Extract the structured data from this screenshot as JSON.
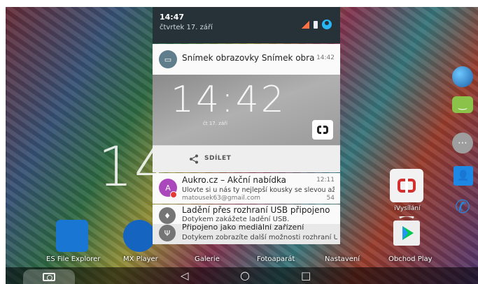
{
  "home": {
    "big_clock": "14",
    "apps": [
      {
        "label": "ES File Explorer"
      },
      {
        "label": "MX Player"
      },
      {
        "label": "Galerie"
      },
      {
        "label": "Fotoaparát"
      },
      {
        "label": "Nastavení"
      },
      {
        "label": "Obchod Play"
      }
    ],
    "ivysilani_label": "iVysílání"
  },
  "shade": {
    "time": "14:47",
    "date": "čtvrtek 17. září"
  },
  "notifications": {
    "screenshot": {
      "title": "Snímek obrazovky Snímek obrazo..",
      "time": "14:42",
      "preview_clock": "14:42",
      "preview_date": "čt 17. září",
      "share_label": "SDÍLET"
    },
    "aukro": {
      "avatar": "A",
      "title": "Aukro.cz – Akční nabídka",
      "time": "12:11",
      "text": "Ulovte si u nás ty nejlepší kousky se slevou až 50 %",
      "sub": "matousek63@gmail.com",
      "count": "54"
    },
    "usb": {
      "title": "Ladění přes rozhraní USB připojeno",
      "text": "Dotykem zakážete ladění USB."
    },
    "media": {
      "title": "Připojeno jako mediální zařízení",
      "text": "Dotykem zobrazíte další možnosti rozhraní U.."
    }
  },
  "nav": {
    "back": "◁",
    "home": "○",
    "recents": "□"
  },
  "colors": {
    "shade_header": "#263238",
    "aukro_avatar": "#ab47bc",
    "accent_blue": "#29b6f6"
  }
}
